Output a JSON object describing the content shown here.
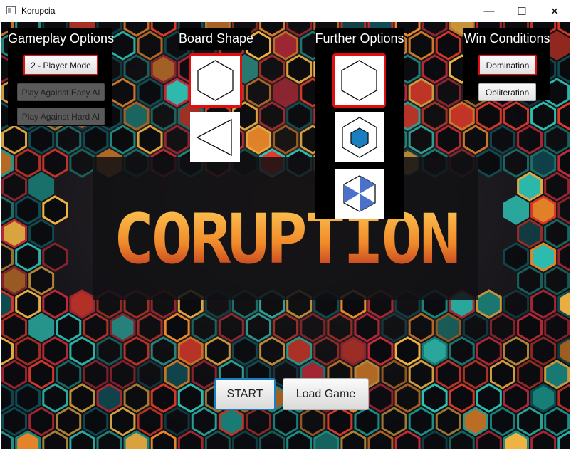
{
  "window": {
    "title": "Korupcia",
    "minimize": "—",
    "maximize": "☐",
    "close": "✕"
  },
  "logo_text": "CORUPTION",
  "gameplay": {
    "heading": "Gameplay Options",
    "buttons": [
      "2 - Player Mode",
      "Play Against Easy AI",
      "Play Against Hard AI"
    ]
  },
  "board": {
    "heading": "Board Shape",
    "shapes": [
      "hexagon-icon",
      "triangle-icon"
    ]
  },
  "further": {
    "heading": "Further Options",
    "options": [
      "hexagon-icon",
      "filled-hexagon-icon",
      "triangle-wedges-hexagon-icon"
    ]
  },
  "win": {
    "heading": "Win Conditions",
    "buttons": [
      "Domination",
      "Obliteration"
    ]
  },
  "actions": {
    "start": "START",
    "load": "Load Game"
  },
  "colors": {
    "selected": "#e01010",
    "accent_blue": "#1a7fc0",
    "wedge_blue": "#4a72c8"
  }
}
